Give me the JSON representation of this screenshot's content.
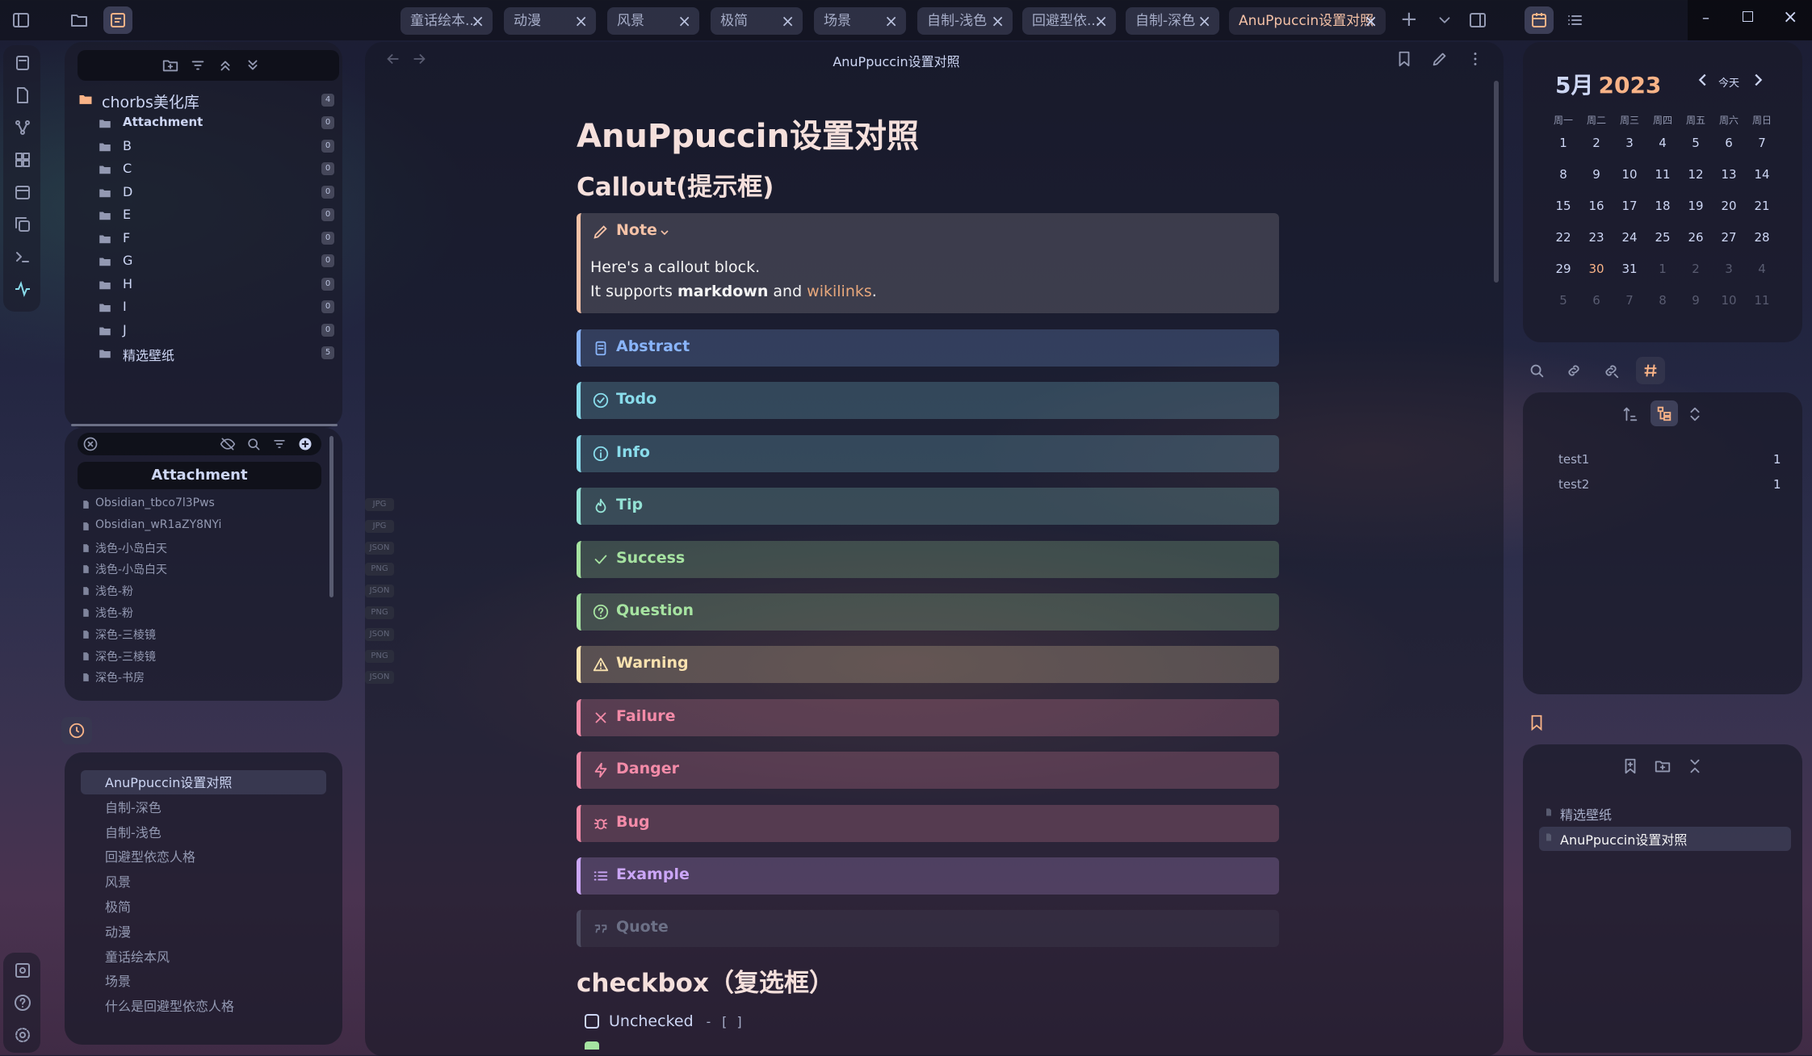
{
  "tabs": [
    {
      "label": "童话绘本..."
    },
    {
      "label": "动漫"
    },
    {
      "label": "风景"
    },
    {
      "label": "极简"
    },
    {
      "label": "场景"
    },
    {
      "label": "自制-浅色"
    },
    {
      "label": "回避型依..."
    },
    {
      "label": "自制-深色"
    },
    {
      "label": "AnuPpuccin设置对照"
    }
  ],
  "file_tree": {
    "vault_name": "chorbs美化库",
    "vault_count": "4",
    "folders": [
      {
        "label": "Attachment",
        "count": "0"
      },
      {
        "label": "B",
        "count": "0"
      },
      {
        "label": "C",
        "count": "0"
      },
      {
        "label": "D",
        "count": "0"
      },
      {
        "label": "E",
        "count": "0"
      },
      {
        "label": "F",
        "count": "0"
      },
      {
        "label": "G",
        "count": "0"
      },
      {
        "label": "H",
        "count": "0"
      },
      {
        "label": "I",
        "count": "0"
      },
      {
        "label": "J",
        "count": "0"
      },
      {
        "label": "精选壁纸",
        "count": "5"
      }
    ]
  },
  "attachment_panel": {
    "title": "Attachment",
    "files": [
      {
        "name": "Obsidian_tbco7l3Pws",
        "type": "JPG"
      },
      {
        "name": "Obsidian_wR1aZY8NYi",
        "type": "JPG"
      },
      {
        "name": "浅色-小岛白天",
        "type": "JSON"
      },
      {
        "name": "浅色-小岛白天",
        "type": "PNG"
      },
      {
        "name": "浅色-粉",
        "type": "JSON"
      },
      {
        "name": "浅色-粉",
        "type": "PNG"
      },
      {
        "name": "深色-三棱镜",
        "type": "JSON"
      },
      {
        "name": "深色-三棱镜",
        "type": "PNG"
      },
      {
        "name": "深色-书房",
        "type": "JSON"
      }
    ]
  },
  "recent_files": [
    "AnuPpuccin设置对照",
    "自制-深色",
    "自制-浅色",
    "回避型依恋人格",
    "风景",
    "极简",
    "动漫",
    "童话绘本风",
    "场景",
    "什么是回避型依恋人格"
  ],
  "editor": {
    "view_title": "AnuPpuccin设置对照",
    "h1": "AnuPpuccin设置对照",
    "h2_callout": "Callout(提示框)",
    "note_title": "Note",
    "note_line1": "Here's a callout block.",
    "note_line2_a": "It supports ",
    "note_line2_b": "markdown",
    "note_line2_c": " and ",
    "note_line2_d": "wikilinks",
    "note_line2_e": ".",
    "callouts": [
      {
        "label": "Abstract",
        "icon": "clipboard-icon",
        "color": "#89b4fa"
      },
      {
        "label": "Todo",
        "icon": "check-circle-icon",
        "color": "#89dceb"
      },
      {
        "label": "Info",
        "icon": "info-icon",
        "color": "#89dceb"
      },
      {
        "label": "Tip",
        "icon": "flame-icon",
        "color": "#94e2d5"
      },
      {
        "label": "Success",
        "icon": "check-icon",
        "color": "#a6e3a1"
      },
      {
        "label": "Question",
        "icon": "help-circle-icon",
        "color": "#a6e3a1"
      },
      {
        "label": "Warning",
        "icon": "alert-triangle-icon",
        "color": "#f9e2af"
      },
      {
        "label": "Failure",
        "icon": "x-icon",
        "color": "#f38ba8"
      },
      {
        "label": "Danger",
        "icon": "zap-icon",
        "color": "#f38ba8"
      },
      {
        "label": "Bug",
        "icon": "bug-icon",
        "color": "#f38ba8"
      },
      {
        "label": "Example",
        "icon": "list-icon",
        "color": "#cba6f7"
      },
      {
        "label": "Quote",
        "icon": "quote-icon",
        "color": "#6c7086"
      }
    ],
    "h2_checkbox": "checkbox（复选框）",
    "checkbox_unchecked_label": "Unchecked",
    "checkbox_unchecked_code": "- [ ]"
  },
  "calendar": {
    "month": "5月",
    "year": "2023",
    "today_label": "今天",
    "weekdays": [
      "周一",
      "周二",
      "周三",
      "周四",
      "周五",
      "周六",
      "周日"
    ],
    "weeks": [
      [
        "1",
        "2",
        "3",
        "4",
        "5",
        "6",
        "7"
      ],
      [
        "8",
        "9",
        "10",
        "11",
        "12",
        "13",
        "14"
      ],
      [
        "15",
        "16",
        "17",
        "18",
        "19",
        "20",
        "21"
      ],
      [
        "22",
        "23",
        "24",
        "25",
        "26",
        "27",
        "28"
      ],
      [
        "29",
        "30",
        "31",
        "1",
        "2",
        "3",
        "4"
      ],
      [
        "5",
        "6",
        "7",
        "8",
        "9",
        "10",
        "11"
      ]
    ],
    "today": "30"
  },
  "tags": [
    {
      "name": "test1",
      "count": "1"
    },
    {
      "name": "test2",
      "count": "1"
    }
  ],
  "bookmarks": [
    {
      "label": "精选壁纸"
    },
    {
      "label": "AnuPpuccin设置对照"
    }
  ],
  "colors": {
    "accent": "#f9b387",
    "note_border": "#f5c2a7",
    "link": "#e8a87c"
  }
}
